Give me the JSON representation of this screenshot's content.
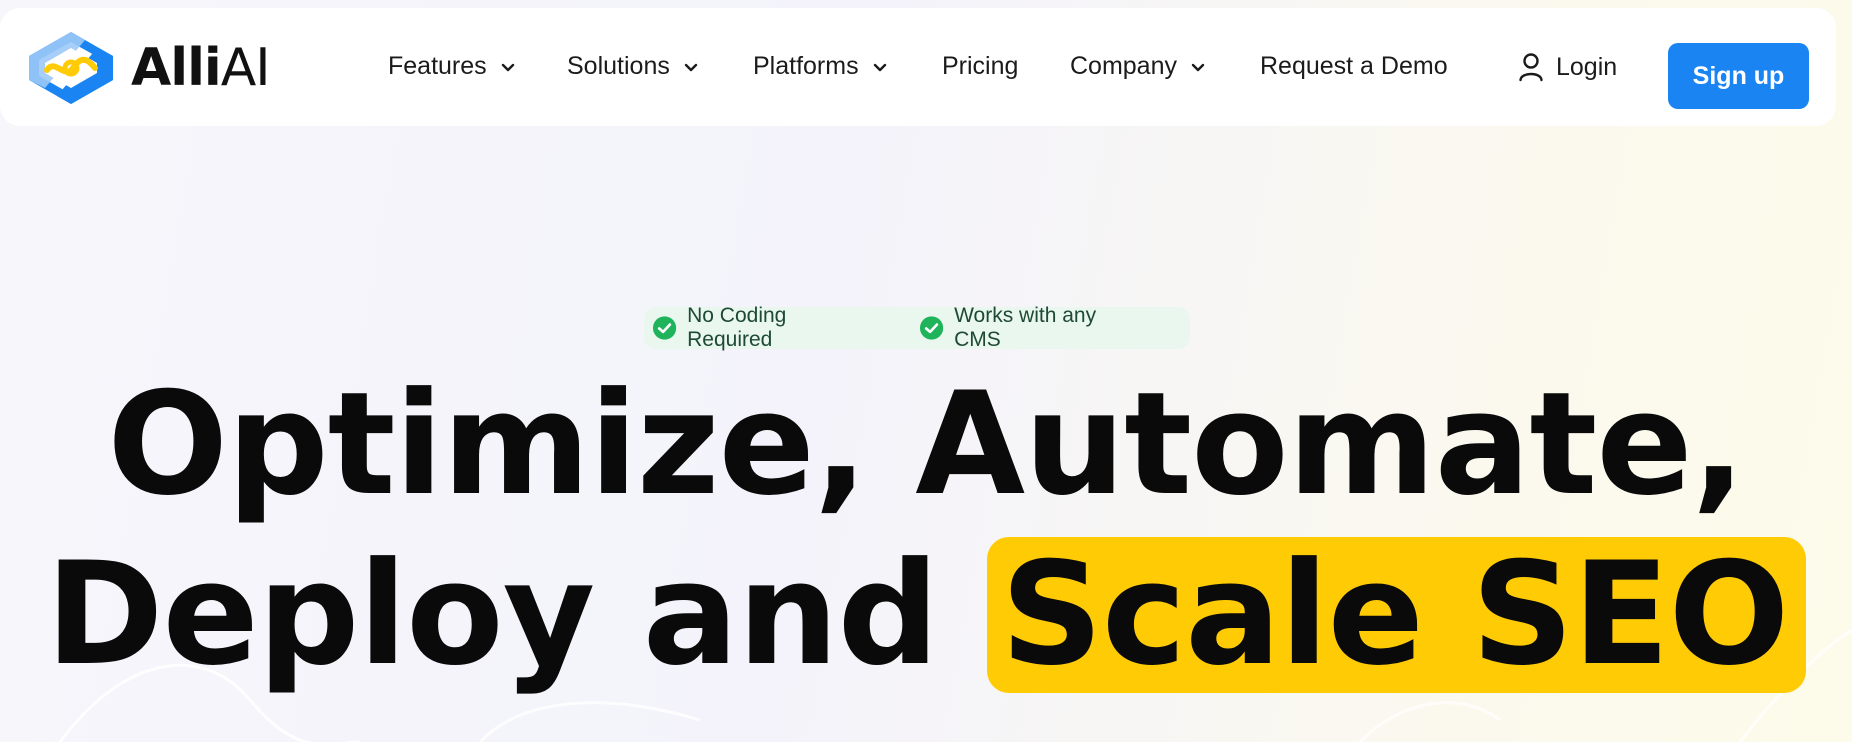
{
  "brand": {
    "name_bold": "Alli",
    "name_light": "AI",
    "logo_colors": {
      "blue": "#1a84f2",
      "light_blue": "#9cc9f7",
      "yellow": "#ffcb05"
    }
  },
  "nav": {
    "items": [
      {
        "label": "Features",
        "has_dropdown": true,
        "icon": "chevron-down-icon"
      },
      {
        "label": "Solutions",
        "has_dropdown": true,
        "icon": "chevron-down-icon"
      },
      {
        "label": "Platforms",
        "has_dropdown": true,
        "icon": "chevron-down-icon"
      },
      {
        "label": "Pricing",
        "has_dropdown": false
      },
      {
        "label": "Company",
        "has_dropdown": true,
        "icon": "chevron-down-icon"
      },
      {
        "label": "Request a Demo",
        "has_dropdown": false
      }
    ],
    "login": {
      "label": "Login",
      "icon": "user-icon"
    },
    "signup": {
      "label": "Sign up",
      "color": "#1a84f2"
    }
  },
  "hero": {
    "badges": [
      {
        "label": "No Coding Required",
        "icon": "check-circle-icon"
      },
      {
        "label": "Works with any CMS",
        "icon": "check-circle-icon"
      }
    ],
    "badge_colors": {
      "background": "#e9f7ef",
      "check": "#1fb35c"
    },
    "headline_line1": "Optimize, Automate,",
    "headline_line2_plain": "Deploy and",
    "headline_highlight": "Scale SEO",
    "highlight_color": "#ffcb05"
  }
}
